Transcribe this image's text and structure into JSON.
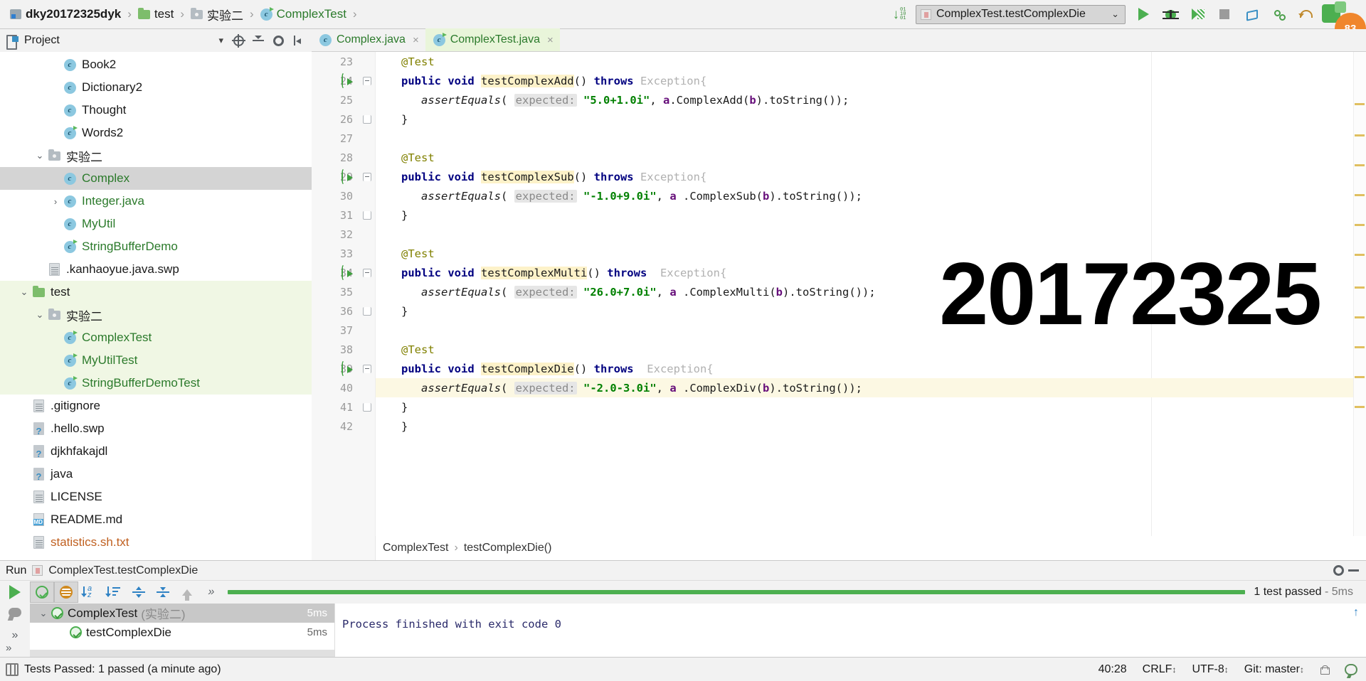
{
  "breadcrumb": {
    "items": [
      {
        "label": "dky20172325dyk",
        "icon": "module-root-icon",
        "kind": "root"
      },
      {
        "label": "test",
        "icon": "folder-green-icon",
        "kind": "folder"
      },
      {
        "label": "实验二",
        "icon": "folder-gray-icon",
        "kind": "folder"
      },
      {
        "label": "ComplexTest",
        "icon": "java-test-class-icon",
        "kind": "class"
      }
    ],
    "separator": "›"
  },
  "toolbar": {
    "binary_icon": "download-binary-icon",
    "run_config": {
      "name": "ComplexTest.testComplexDie",
      "chevron": "⌄",
      "config_icon": "junit-config-icon"
    },
    "buttons": [
      {
        "name": "run-button",
        "icon": "play-icon"
      },
      {
        "name": "debug-button",
        "icon": "bug-icon"
      },
      {
        "name": "run-with-coverage-button",
        "icon": "coverage-icon"
      },
      {
        "name": "stop-button",
        "icon": "stop-icon"
      },
      {
        "name": "vcs-update-button",
        "icon": "vcs-update-icon"
      },
      {
        "name": "vcs-branch-button",
        "icon": "vcs-branch-icon"
      },
      {
        "name": "undo-button",
        "icon": "undo-icon"
      }
    ],
    "badge": "83"
  },
  "project_panel": {
    "title": "Project",
    "chevron": "▾",
    "icons": [
      "locate-icon",
      "collapse-all-icon",
      "settings-gear-icon",
      "hide-panel-icon"
    ],
    "tree": [
      {
        "label": "Book2",
        "icon": "java-class-icon",
        "indent": 4,
        "color": "black",
        "twisty": ""
      },
      {
        "label": "Dictionary2",
        "icon": "java-class-icon",
        "indent": 4,
        "color": "black",
        "twisty": ""
      },
      {
        "label": "Thought",
        "icon": "java-class-icon",
        "indent": 4,
        "color": "black",
        "twisty": ""
      },
      {
        "label": "Words2",
        "icon": "java-test-class-icon",
        "indent": 4,
        "color": "black",
        "twisty": ""
      },
      {
        "label": "实验二",
        "icon": "folder-gray-icon",
        "indent": 3,
        "color": "black",
        "twisty": "⌄"
      },
      {
        "label": "Complex",
        "icon": "java-class-icon",
        "indent": 4,
        "color": "green",
        "twisty": "",
        "selected": true
      },
      {
        "label": "Integer.java",
        "icon": "java-class-icon",
        "indent": 4,
        "color": "green",
        "twisty": "›"
      },
      {
        "label": "MyUtil",
        "icon": "java-class-icon",
        "indent": 4,
        "color": "green",
        "twisty": ""
      },
      {
        "label": "StringBufferDemo",
        "icon": "java-test-class-icon",
        "indent": 4,
        "color": "green",
        "twisty": ""
      },
      {
        "label": ".kanhaoyue.java.swp",
        "icon": "file-icon",
        "indent": 3,
        "color": "black",
        "twisty": ""
      },
      {
        "label": "test",
        "icon": "folder-green-icon",
        "indent": 2,
        "color": "black",
        "twisty": "⌄",
        "testscope": true
      },
      {
        "label": "实验二",
        "icon": "folder-gray-icon",
        "indent": 3,
        "color": "black",
        "twisty": "⌄",
        "testscope": true
      },
      {
        "label": "ComplexTest",
        "icon": "java-test-class-icon",
        "indent": 4,
        "color": "green",
        "twisty": "",
        "testscope": true
      },
      {
        "label": "MyUtilTest",
        "icon": "java-test-class-icon",
        "indent": 4,
        "color": "green",
        "twisty": "",
        "testscope": true
      },
      {
        "label": "StringBufferDemoTest",
        "icon": "java-test-class-icon",
        "indent": 4,
        "color": "green",
        "twisty": "",
        "testscope": true
      },
      {
        "label": ".gitignore",
        "icon": "file-icon",
        "indent": 2,
        "color": "black",
        "twisty": ""
      },
      {
        "label": ".hello.swp",
        "icon": "file-unknown-icon",
        "indent": 2,
        "color": "black",
        "twisty": ""
      },
      {
        "label": "djkhfakajdl",
        "icon": "file-unknown-icon",
        "indent": 2,
        "color": "black",
        "twisty": ""
      },
      {
        "label": "java",
        "icon": "file-unknown-icon",
        "indent": 2,
        "color": "black",
        "twisty": ""
      },
      {
        "label": "LICENSE",
        "icon": "file-icon",
        "indent": 2,
        "color": "black",
        "twisty": ""
      },
      {
        "label": "README.md",
        "icon": "markdown-file-icon",
        "indent": 2,
        "color": "black",
        "twisty": ""
      },
      {
        "label": "statistics.sh.txt",
        "icon": "file-icon",
        "indent": 2,
        "color": "orange",
        "twisty": ""
      }
    ]
  },
  "editor": {
    "tabs": [
      {
        "label": "Complex.java",
        "icon": "java-class-icon",
        "active": false,
        "close": "×"
      },
      {
        "label": "ComplexTest.java",
        "icon": "java-test-class-icon",
        "active": true,
        "close": "×"
      }
    ],
    "watermark": "20172325",
    "breadcrumb": {
      "class": "ComplexTest",
      "sep": "›",
      "method": "testComplexDie()"
    },
    "lines": [
      {
        "n": "23",
        "indent": 1,
        "seg": [
          {
            "t": "@Test",
            "c": "ann"
          }
        ]
      },
      {
        "n": "24",
        "indent": 1,
        "runmark": true,
        "fold": "top",
        "seg": [
          {
            "t": "public void ",
            "c": "kw"
          },
          {
            "t": "testComplexAdd",
            "c": "mname"
          },
          {
            "t": "() ",
            "c": "plain"
          },
          {
            "t": "throws ",
            "c": "kw"
          },
          {
            "t": "Exception{",
            "c": "typ"
          }
        ]
      },
      {
        "n": "25",
        "indent": 2,
        "seg": [
          {
            "t": "assertEquals",
            "c": "ital"
          },
          {
            "t": "( ",
            "c": "plain"
          },
          {
            "t": "expected:",
            "c": "hintparam"
          },
          {
            "t": " ",
            "c": "plain"
          },
          {
            "t": "\"5.0+1.0i\"",
            "c": "str"
          },
          {
            "t": ", ",
            "c": "plain"
          },
          {
            "t": "a",
            "c": "fieldv"
          },
          {
            "t": ".ComplexAdd(",
            "c": "plain"
          },
          {
            "t": "b",
            "c": "fieldv"
          },
          {
            "t": ").toString());",
            "c": "plain"
          }
        ]
      },
      {
        "n": "26",
        "indent": 1,
        "fold": "bot",
        "seg": [
          {
            "t": "}",
            "c": "plain"
          }
        ]
      },
      {
        "n": "27",
        "indent": 0,
        "seg": []
      },
      {
        "n": "28",
        "indent": 1,
        "seg": [
          {
            "t": "@Test",
            "c": "ann"
          }
        ]
      },
      {
        "n": "29",
        "indent": 1,
        "runmark": true,
        "fold": "top",
        "seg": [
          {
            "t": "public void ",
            "c": "kw"
          },
          {
            "t": "testComplexSub",
            "c": "mname"
          },
          {
            "t": "() ",
            "c": "plain"
          },
          {
            "t": "throws ",
            "c": "kw"
          },
          {
            "t": "Exception{",
            "c": "typ"
          }
        ]
      },
      {
        "n": "30",
        "indent": 2,
        "seg": [
          {
            "t": "assertEquals",
            "c": "ital"
          },
          {
            "t": "( ",
            "c": "plain"
          },
          {
            "t": "expected:",
            "c": "hintparam"
          },
          {
            "t": " ",
            "c": "plain"
          },
          {
            "t": "\"-1.0+9.0i\"",
            "c": "str"
          },
          {
            "t": ", ",
            "c": "plain"
          },
          {
            "t": "a",
            "c": "fieldv"
          },
          {
            "t": " .ComplexSub(",
            "c": "plain"
          },
          {
            "t": "b",
            "c": "fieldv"
          },
          {
            "t": ").toString());",
            "c": "plain"
          }
        ]
      },
      {
        "n": "31",
        "indent": 1,
        "fold": "bot",
        "seg": [
          {
            "t": "}",
            "c": "plain"
          }
        ]
      },
      {
        "n": "32",
        "indent": 0,
        "seg": []
      },
      {
        "n": "33",
        "indent": 1,
        "seg": [
          {
            "t": "@Test",
            "c": "ann"
          }
        ]
      },
      {
        "n": "34",
        "indent": 1,
        "runmark": true,
        "fold": "top",
        "seg": [
          {
            "t": "public void ",
            "c": "kw"
          },
          {
            "t": "testComplexMulti",
            "c": "mname"
          },
          {
            "t": "() ",
            "c": "plain"
          },
          {
            "t": "throws ",
            "c": "kw"
          },
          {
            "t": " Exception{",
            "c": "typ"
          }
        ]
      },
      {
        "n": "35",
        "indent": 2,
        "seg": [
          {
            "t": "assertEquals",
            "c": "ital"
          },
          {
            "t": "( ",
            "c": "plain"
          },
          {
            "t": "expected:",
            "c": "hintparam"
          },
          {
            "t": " ",
            "c": "plain"
          },
          {
            "t": "\"26.0+7.0i\"",
            "c": "str"
          },
          {
            "t": ", ",
            "c": "plain"
          },
          {
            "t": "a",
            "c": "fieldv"
          },
          {
            "t": " .ComplexMulti(",
            "c": "plain"
          },
          {
            "t": "b",
            "c": "fieldv"
          },
          {
            "t": ").toString());",
            "c": "plain"
          }
        ]
      },
      {
        "n": "36",
        "indent": 1,
        "fold": "bot",
        "seg": [
          {
            "t": "}",
            "c": "plain"
          }
        ]
      },
      {
        "n": "37",
        "indent": 0,
        "seg": []
      },
      {
        "n": "38",
        "indent": 1,
        "seg": [
          {
            "t": "@Test",
            "c": "ann"
          }
        ]
      },
      {
        "n": "39",
        "indent": 1,
        "runmark": true,
        "fold": "top",
        "seg": [
          {
            "t": "public void ",
            "c": "kw"
          },
          {
            "t": "testComplexDie",
            "c": "mname"
          },
          {
            "t": "() ",
            "c": "plain"
          },
          {
            "t": "throws ",
            "c": "kw"
          },
          {
            "t": " Exception{",
            "c": "typ"
          }
        ]
      },
      {
        "n": "40",
        "indent": 2,
        "current": true,
        "seg": [
          {
            "t": "assertEquals",
            "c": "ital"
          },
          {
            "t": "( ",
            "c": "plain"
          },
          {
            "t": "expected:",
            "c": "hintparam"
          },
          {
            "t": " ",
            "c": "plain"
          },
          {
            "t": "\"-2.0-3.0i\"",
            "c": "str"
          },
          {
            "t": ", ",
            "c": "plain"
          },
          {
            "t": "a",
            "c": "fieldv"
          },
          {
            "t": " .ComplexDiv(",
            "c": "plain"
          },
          {
            "t": "b",
            "c": "fieldv"
          },
          {
            "t": ").toString());",
            "c": "plain"
          }
        ]
      },
      {
        "n": "41",
        "indent": 1,
        "fold": "bot",
        "seg": [
          {
            "t": "}",
            "c": "plain"
          }
        ]
      },
      {
        "n": "42",
        "indent": 1,
        "seg": [
          {
            "t": "}",
            "c": "plain"
          }
        ]
      }
    ]
  },
  "run_window": {
    "header": {
      "label": "Run",
      "config_name": "ComplexTest.testComplexDie",
      "icons": [
        "settings-gear-icon",
        "hide-panel-icon"
      ]
    },
    "rail": [
      {
        "name": "rerun-button",
        "icon": "play-icon"
      },
      {
        "name": "thread-dump-button",
        "icon": "dump-icon"
      },
      {
        "name": "more-rail-button",
        "icon": "chevron-double-right-icon"
      }
    ],
    "toolbar": [
      {
        "name": "show-passed-toggle",
        "icon": "check-circle-icon",
        "active": true
      },
      {
        "name": "show-ignored-toggle",
        "icon": "ignored-circle-icon",
        "active": true
      },
      {
        "name": "sort-alphabetically-button",
        "icon": "sort-alpha-icon",
        "active": false
      },
      {
        "name": "sort-by-duration-button",
        "icon": "sort-duration-icon",
        "active": false
      },
      {
        "name": "expand-all-button",
        "icon": "expand-all-icon",
        "active": false
      },
      {
        "name": "collapse-all-button",
        "icon": "collapse-all-icon",
        "active": false
      },
      {
        "name": "prev-failed-button",
        "icon": "arrow-up-icon",
        "active": false
      },
      {
        "name": "more-options-button",
        "icon": "chevron-double-right-icon",
        "active": false
      }
    ],
    "status_text": "1 test passed",
    "status_duration": "- 5ms",
    "tests": [
      {
        "name": "ComplexTest",
        "scope": "(实验二)",
        "duration": "5ms",
        "twisty": "⌄",
        "selected": true,
        "indent": 0
      },
      {
        "name": "testComplexDie",
        "scope": "",
        "duration": "5ms",
        "twisty": "",
        "selected": false,
        "indent": 1
      }
    ],
    "console": "Process finished with exit code 0"
  },
  "status_bar": {
    "left": "Tests Passed: 1 passed (a minute ago)",
    "caret": "40:28",
    "line_separator": "CRLF",
    "encoding": "UTF-8",
    "git_branch": "Git: master",
    "arrows": "↕",
    "icons": [
      "lock-icon",
      "balloon-icon"
    ]
  },
  "colors": {
    "accent_green": "#4caf50",
    "test_scope_bg": "#f0f7e4",
    "selection_gray": "#d4d4d4",
    "current_line": "#fcf8e3",
    "string_green": "#008000",
    "keyword_blue": "#000080",
    "field_purple": "#660e7a",
    "annotation_olive": "#808000",
    "method_highlight": "#fdf2c9",
    "orange_badge": "#f0862c"
  }
}
